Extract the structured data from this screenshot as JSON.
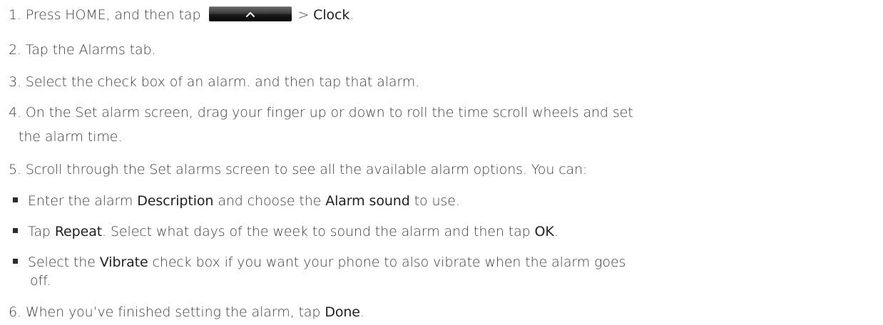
{
  "steps": {
    "s1": {
      "pre": "1. Press HOME, and then tap",
      "post_prefix": "> ",
      "post_bold": "Clock",
      "post_suffix": ".",
      "icon": "chevron-up-icon"
    },
    "s2": {
      "text": "2. Tap the Alarms tab."
    },
    "s3": {
      "text": "3. Select the check box of an alarm. and then tap that alarm."
    },
    "s4": {
      "line1": "4. On the Set alarm screen, drag your finger up or down to roll the time scroll wheels and set",
      "line2": "the alarm time."
    },
    "s5": {
      "text": "5. Scroll through the Set alarms screen to see all the available alarm options. You can:"
    },
    "bullets": {
      "b1": {
        "a": "Enter the alarm ",
        "b": "Description",
        "c": " and choose the ",
        "d": "Alarm sound",
        "e": " to use."
      },
      "b2": {
        "a": "Tap ",
        "b": "Repeat",
        "c": ". Select what days of the week to sound the alarm and then tap ",
        "d": "OK",
        "e": "."
      },
      "b3": {
        "a": "Select the ",
        "b": "Vibrate",
        "c": " check box if you want your phone to also vibrate when the alarm goes",
        "line2": "off."
      }
    },
    "s6": {
      "pre": "6. When you’ve finished setting the alarm, tap ",
      "bold": "Done",
      "post": "."
    }
  }
}
